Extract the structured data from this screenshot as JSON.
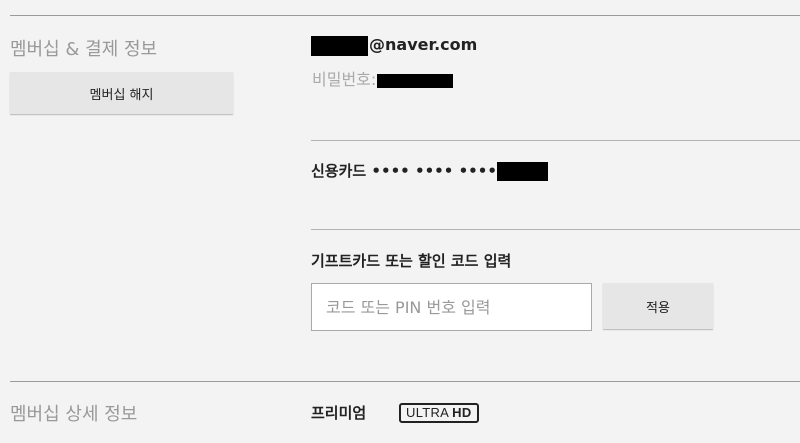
{
  "membership_billing": {
    "section_title": "멤버십 & 결제 정보",
    "cancel_button_label": "멤버십 해지",
    "email_domain": "@naver.com",
    "password_label": "비밀번호:",
    "card_label": "신용카드 •••• •••• ••••",
    "gift_code_title": "기프트카드 또는 할인 코드 입력",
    "gift_code_placeholder": "코드 또는 PIN 번호 입력",
    "apply_button_label": "적용"
  },
  "plan_details": {
    "section_title": "멤버십 상세 정보",
    "plan_name": "프리미엄",
    "badge_ultra": "ULTRA",
    "badge_hd": "HD"
  }
}
